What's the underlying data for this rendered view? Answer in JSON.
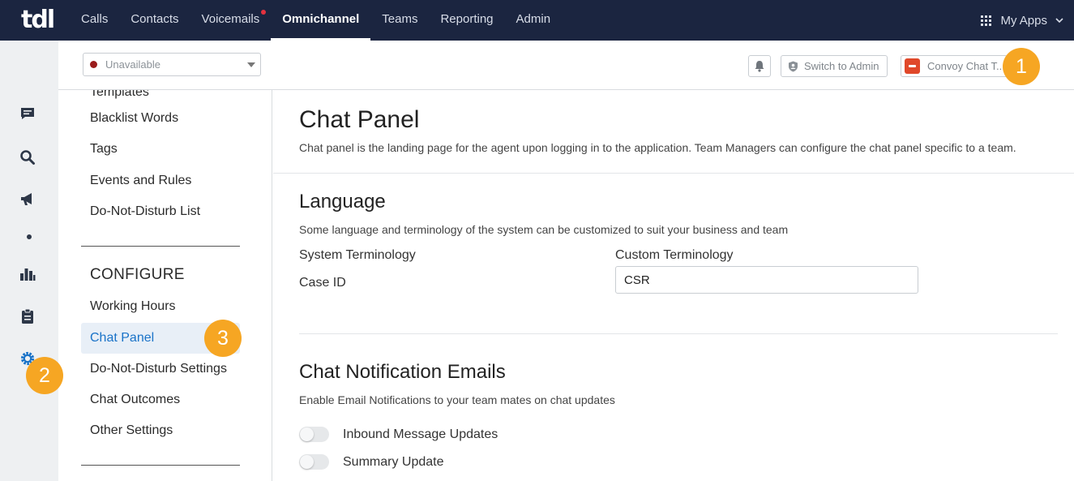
{
  "logo": "tdl",
  "nav": {
    "items": [
      {
        "label": "Calls",
        "active": false,
        "dot": false
      },
      {
        "label": "Contacts",
        "active": false,
        "dot": false
      },
      {
        "label": "Voicemails",
        "active": false,
        "dot": true
      },
      {
        "label": "Omnichannel",
        "active": true,
        "dot": false
      },
      {
        "label": "Teams",
        "active": false,
        "dot": false
      },
      {
        "label": "Reporting",
        "active": false,
        "dot": false
      },
      {
        "label": "Admin",
        "active": false,
        "dot": false
      }
    ],
    "my_apps": "My Apps"
  },
  "rail": {
    "icons": [
      "chat-icon",
      "search-icon",
      "megaphone-icon",
      "dot-icon",
      "bar-chart-icon",
      "clipboard-icon",
      "settings-gear-icon"
    ]
  },
  "status": {
    "value": "Unavailable",
    "color": "#9a1c1c"
  },
  "header": {
    "switch_admin": "Switch to Admin",
    "team_name": "Convoy Chat T..."
  },
  "badges": {
    "one": "1",
    "two": "2",
    "three": "3",
    "color": "#f6a623"
  },
  "sidebar": {
    "top_items": [
      "Templates",
      "Blacklist Words",
      "Tags",
      "Events and Rules",
      "Do-Not-Disturb List"
    ],
    "configure_heading": "CONFIGURE",
    "configure_items": [
      "Working Hours",
      "Chat Panel",
      "Do-Not-Disturb Settings",
      "Chat Outcomes",
      "Other Settings"
    ],
    "active_item": "Chat Panel",
    "active_color": "#1a73c8"
  },
  "main": {
    "title": "Chat Panel",
    "description": "Chat panel is the landing page for the agent upon logging in to the application. Team Managers can configure the chat panel specific to a team.",
    "language": {
      "title": "Language",
      "description": "Some language and terminology of the system can be customized to suit your business and team",
      "system_header": "System Terminology",
      "custom_header": "Custom Terminology",
      "rows": [
        {
          "system": "Case ID",
          "custom": "CSR"
        }
      ]
    },
    "notifications": {
      "title": "Chat Notification Emails",
      "description": "Enable Email Notifications to your team mates on chat updates",
      "toggles": [
        {
          "label": "Inbound Message Updates",
          "on": false
        },
        {
          "label": "Summary Update",
          "on": false
        }
      ]
    }
  }
}
